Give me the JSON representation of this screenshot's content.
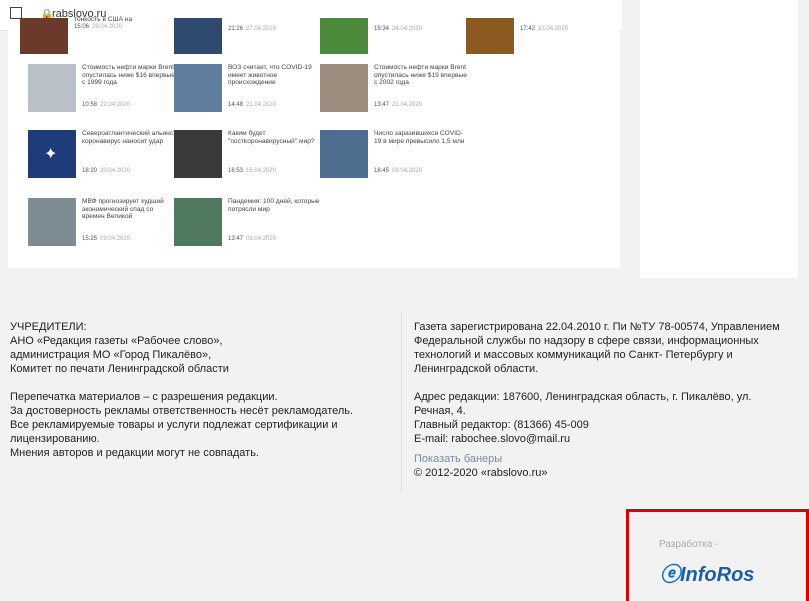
{
  "browser": {
    "url": "rabslovo.ru"
  },
  "news": [
    {
      "title": "тонкость в США на",
      "time": "15:06",
      "date": "29.04.2020"
    },
    {
      "title": "",
      "time": "21:26",
      "date": "27.04.2020"
    },
    {
      "title": "",
      "time": "19:34",
      "date": "24.04.2020"
    },
    {
      "title": "",
      "time": "17:42",
      "date": "23.04.2020"
    },
    {
      "title": "Стоимость нефти марки Brent опустилась ниже $16 впервые с 1999 года",
      "time": "10:58",
      "date": "22.04.2020"
    },
    {
      "title": "ВОЗ считает, что COVID-19 имеет животное происхождение",
      "time": "14:48",
      "date": "21.04.2020"
    },
    {
      "title": "Стоимость нефти марки Brent опустилась ниже $19 впервые с 2002 года",
      "time": "13:47",
      "date": "21.04.2020"
    },
    {
      "title": "Североатлантический альянс: коронавирус наносит удар",
      "time": "18:20",
      "date": "20.04.2020"
    },
    {
      "title": "Каким будет \"постkoронавирусный\" мир?",
      "time": "16:53",
      "date": "15.04.2020"
    },
    {
      "title": "Число заразившихся COVID-19 в мире превысило 1,5 млн",
      "time": "18:45",
      "date": "09.04.2020"
    },
    {
      "title": "МВФ прогнозирует худший экономический спад со времен Великой",
      "time": "15:25",
      "date": "09.04.2020"
    },
    {
      "title": "Пандемия: 100 дней, которые потрясли мир",
      "time": "13:47",
      "date": "09.04.2020"
    }
  ],
  "footer": {
    "left": {
      "founders_heading": "УЧРЕДИТЕЛИ:",
      "founders": [
        "АНО «Редакция газеты «Рабочее слово»,",
        "администрация МО «Город Пикалёво»,",
        "Комитет по печати Ленинградской области"
      ],
      "notes": [
        "Перепечатка материалов – с разрешения редакции.",
        "За достоверность рекламы ответственность несёт рекламодатель.",
        "Все рекламируемые товары и услуги подлежат сертификации и лицензированию.",
        "Мнения авторов и редакции могут не совпадать."
      ]
    },
    "right": {
      "registration": "Газета зарегистрирована 22.04.2010 г. Пи №ТУ 78-00574, Управлением Федеральной службы по надзору в сфере связи, информационных технологий и массовых коммуникаций по Санкт- Петербургу и Ленинградской области.",
      "address": "Адрес редакции: 187600, Ленинградская область, г. Пикалёво, ул. Речная, 4.",
      "editor": "Главный редактор: (81366) 45-009",
      "email": "E-mail: rabochee.slovo@mail.ru",
      "banners_link": "Показать банеры",
      "copyright": "© 2012-2020 «rabslovo.ru»"
    }
  },
  "developer": {
    "label": "Разработка -",
    "logo": "InfoRos",
    "accent": "#e10000",
    "logo_color": "#1d5ea8"
  }
}
